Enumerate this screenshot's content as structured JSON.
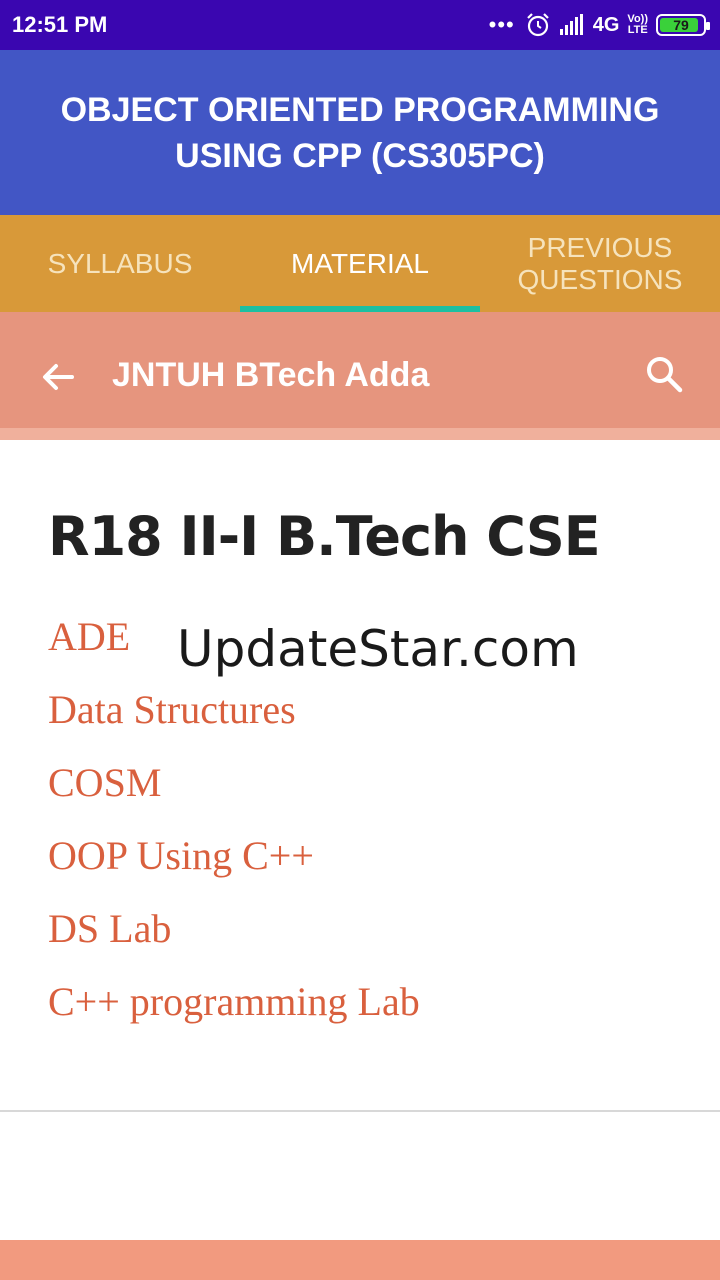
{
  "status_bar": {
    "time": "12:51 PM",
    "dots": "•••",
    "network": "4G",
    "volte_top": "Vo))",
    "volte_bottom": "LTE",
    "battery": "79"
  },
  "app_bar": {
    "title": "OBJECT ORIENTED PROGRAMMING USING CPP (CS305PC)"
  },
  "tabs": [
    {
      "label": "SYLLABUS",
      "active": false
    },
    {
      "label": "MATERIAL",
      "active": true
    },
    {
      "label": "PREVIOUS QUESTIONS",
      "active": false
    }
  ],
  "web_header": {
    "title": "JNTUH BTech Adda"
  },
  "content": {
    "heading": "R18 II-I B.Tech CSE",
    "links": [
      "ADE",
      "Data Structures",
      "COSM",
      "OOP Using C++",
      "DS Lab",
      "C++ programming Lab"
    ],
    "watermark": "UpdateStar.com"
  },
  "colors": {
    "status_bar": "#3a06b0",
    "app_bar": "#4256c5",
    "tabs": "#d89939",
    "tab_indicator": "#1dbfa1",
    "web_header": "#e6957e",
    "link": "#d9603e"
  }
}
